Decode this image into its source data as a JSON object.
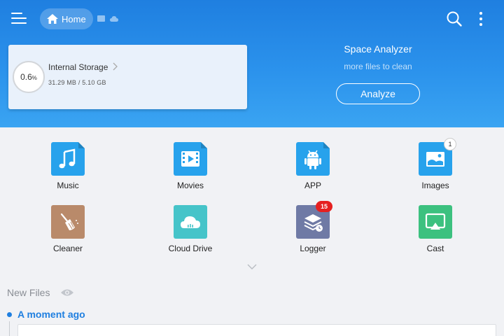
{
  "toolbar": {
    "home_label": "Home"
  },
  "storage": {
    "percent": "0.6",
    "percent_unit": "%",
    "title": "Internal Storage",
    "size": "31.29 MB / 5.10 GB"
  },
  "analyzer": {
    "title": "Space Analyzer",
    "subtitle": "more files to clean",
    "button": "Analyze"
  },
  "categories": [
    {
      "label": "Music",
      "icon": "music-icon",
      "color": "#27a2ec"
    },
    {
      "label": "Movies",
      "icon": "movie-icon",
      "color": "#27a2ec"
    },
    {
      "label": "APP",
      "icon": "android-icon",
      "color": "#27a2ec"
    },
    {
      "label": "Images",
      "icon": "image-icon",
      "color": "#27a2ec",
      "badge": "1"
    },
    {
      "label": "Cleaner",
      "icon": "broom-icon",
      "color": "#b98a6a"
    },
    {
      "label": "Cloud Drive",
      "icon": "cloud-icon",
      "color": "#46c4c9"
    },
    {
      "label": "Logger",
      "icon": "logger-icon",
      "color": "#6f7aa5",
      "badge": "15"
    },
    {
      "label": "Cast",
      "icon": "cast-icon",
      "color": "#3cc17f"
    }
  ],
  "new_files": {
    "heading": "New Files",
    "group_label": "A moment ago"
  },
  "colors": {
    "header_top": "#1f7fe0",
    "header_bottom": "#3aa4f2",
    "accent": "#1f7fe0",
    "badge_red": "#e52020"
  }
}
